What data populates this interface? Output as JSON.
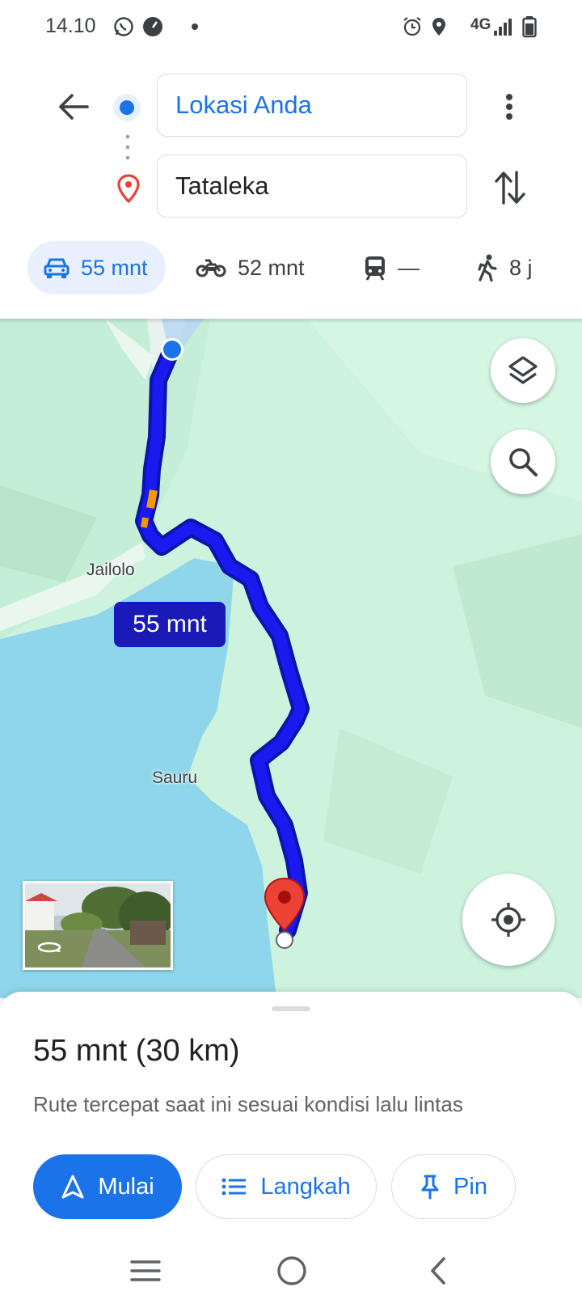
{
  "status_bar": {
    "time": "14.10",
    "network": "4G"
  },
  "directions": {
    "origin": "Lokasi Anda",
    "destination": "Tataleka"
  },
  "modes": [
    {
      "icon": "car-icon",
      "label": "55 mnt",
      "active": true
    },
    {
      "icon": "motorcycle-icon",
      "label": "52 mnt",
      "active": false
    },
    {
      "icon": "transit-icon",
      "label": "—",
      "active": false
    },
    {
      "icon": "walk-icon",
      "label": "8 j",
      "active": false
    }
  ],
  "map": {
    "eta_label": "55 mnt",
    "places": [
      "Jailolo",
      "Sauru"
    ],
    "colors": {
      "land": "#cdf3de",
      "water": "#8fd6ea",
      "route": "#1a1af0",
      "route_outline": "#0d14a8",
      "traffic": "#f29900",
      "destination_pin": "#ea4335"
    }
  },
  "sheet": {
    "summary": "55 mnt (30 km)",
    "description": "Rute tercepat saat ini sesuai kondisi lalu lintas",
    "start_label": "Mulai",
    "steps_label": "Langkah",
    "pin_label": "Pin"
  },
  "accent": "#1a73e8"
}
